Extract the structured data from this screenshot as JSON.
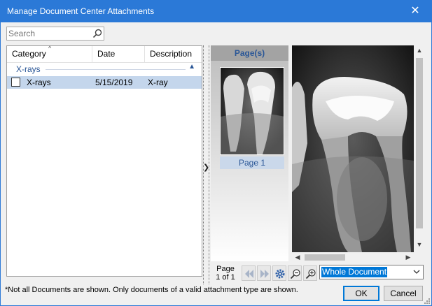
{
  "window": {
    "title": "Manage Document Center Attachments",
    "close_glyph": "✕",
    "accent_color": "#2b79d7"
  },
  "search": {
    "placeholder": "Search",
    "value": "",
    "icon": "search-icon"
  },
  "list": {
    "columns": [
      {
        "label": "Category"
      },
      {
        "label": "Date"
      },
      {
        "label": "Description"
      }
    ],
    "sort_glyph": "^",
    "groups": [
      {
        "label": "X-rays",
        "collapse_glyph": "▲",
        "rows": [
          {
            "checked": false,
            "category": "X-rays",
            "date": "5/15/2019",
            "description": "X-ray",
            "selected": true
          }
        ]
      }
    ]
  },
  "pages": {
    "header": "Page(s)",
    "thumbnails": [
      {
        "label": "Page 1"
      }
    ]
  },
  "viewer": {
    "page_counter_label": "Page",
    "page_counter_value": "1 of 1",
    "zoom_selected": "Whole Document",
    "tools": [
      "first-page-icon",
      "last-page-icon",
      "settings-gear-icon",
      "zoom-out-icon",
      "zoom-in-icon"
    ]
  },
  "footer": {
    "note": "*Not all Documents are shown. Only documents of a valid attachment type are shown.",
    "ok_label": "OK",
    "cancel_label": "Cancel"
  }
}
